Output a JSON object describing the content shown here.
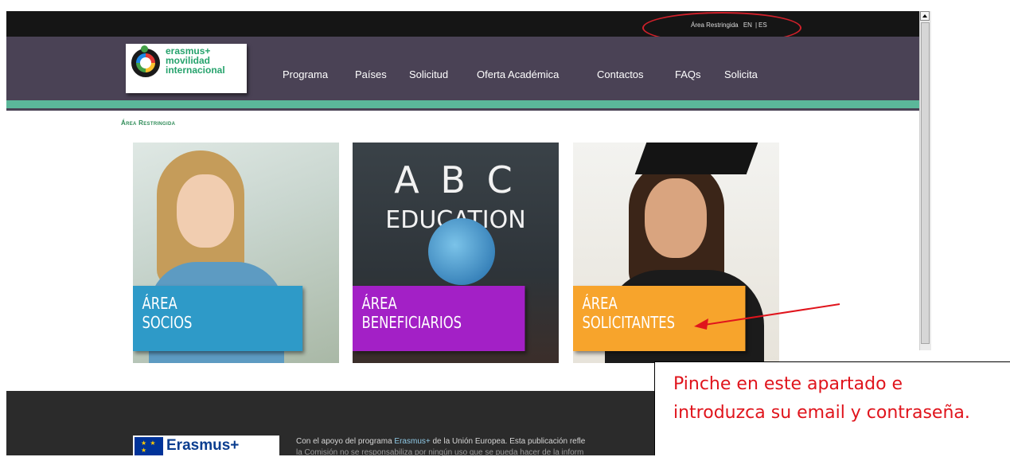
{
  "topbar": {
    "restricted_link": "Área Restringida",
    "lang_en": "EN",
    "lang_sep": "|",
    "lang_es": "ES"
  },
  "logo": {
    "line1": "erasmus+",
    "line2": "movilidad",
    "line3": "internacional"
  },
  "nav": {
    "items": [
      {
        "label": "Programa"
      },
      {
        "label": "Países"
      },
      {
        "label": "Solicitud"
      },
      {
        "label": "Oferta Académica"
      },
      {
        "label": "Contactos"
      },
      {
        "label": "FAQs"
      },
      {
        "label": "Solicita"
      }
    ]
  },
  "breadcrumb": "Área Restringida",
  "tiles": {
    "socios": {
      "line1": "ÁREA",
      "line2": "SOCIOS"
    },
    "beneficiarios": {
      "line1": "ÁREA",
      "line2": "BENEFICIARIOS",
      "board_letters": "A B C",
      "board_word": "EDUCATION"
    },
    "solicitantes": {
      "line1": "ÁREA",
      "line2": "SOLICITANTES"
    }
  },
  "footer": {
    "text_before": "Con el apoyo del programa ",
    "text_link": "Erasmus+",
    "text_after": " de la Unión Europea. Esta publicación refle",
    "text_line2": "la Comisión no se responsabiliza por ningún uso que se pueda hacer de la inform",
    "eu_logo_text": "Erasmus+"
  },
  "callout": {
    "line1": "Pinche en este apartado e",
    "line2": "introduzca su email y contraseña."
  },
  "colors": {
    "navbar": "#4a4255",
    "accent": "#5bb79a",
    "socios": "#2e9ac8",
    "beneficiarios": "#a320c6",
    "solicitantes": "#f7a42c",
    "annotation": "#e0141c"
  }
}
